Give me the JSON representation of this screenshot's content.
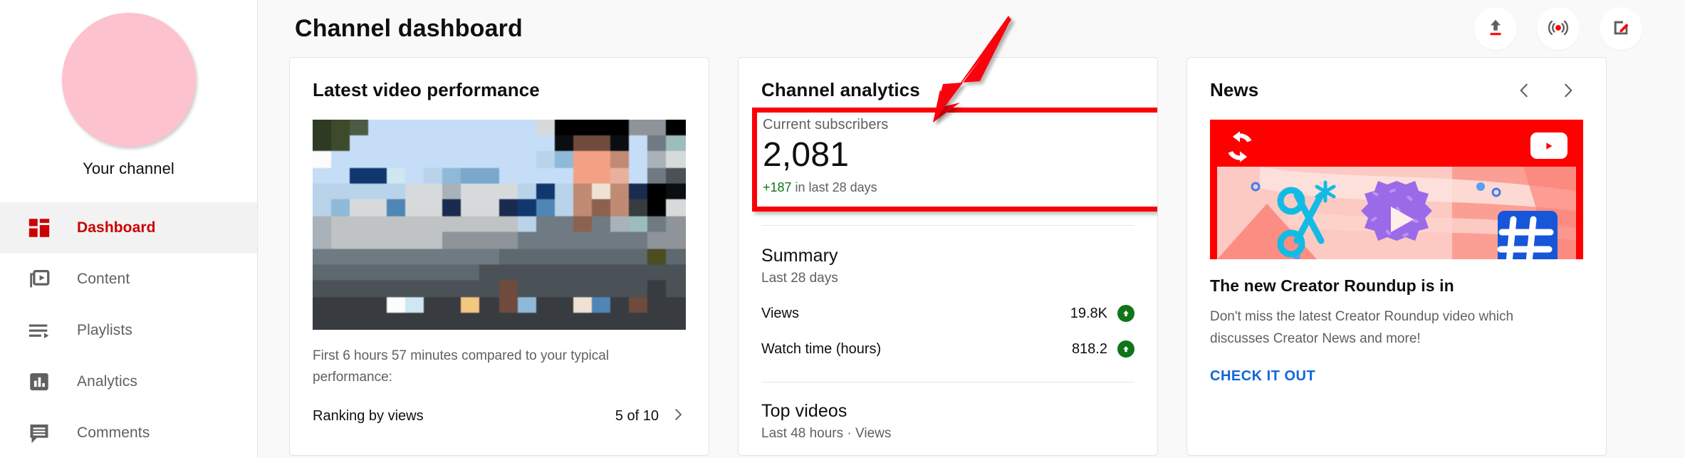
{
  "sidebar": {
    "channel_name": "Your channel",
    "avatar": {
      "icon": "channel-avatar",
      "color": "#fcc2cd"
    },
    "items": [
      {
        "label": "Dashboard",
        "icon": "dashboard-grid-icon",
        "active": true
      },
      {
        "label": "Content",
        "icon": "video-library-icon",
        "active": false
      },
      {
        "label": "Playlists",
        "icon": "playlist-icon",
        "active": false
      },
      {
        "label": "Analytics",
        "icon": "bar-chart-icon",
        "active": false
      },
      {
        "label": "Comments",
        "icon": "comment-bubble-icon",
        "active": false
      }
    ]
  },
  "header": {
    "title": "Channel dashboard",
    "actions": [
      {
        "name": "upload-video-button",
        "icon": "upload-arrow-icon",
        "tooltip": "Upload videos"
      },
      {
        "name": "go-live-button",
        "icon": "live-broadcast-icon",
        "tooltip": "Go live"
      },
      {
        "name": "create-post-button",
        "icon": "edit-square-pencil-icon",
        "tooltip": "Create post"
      }
    ]
  },
  "latest_video": {
    "title": "Latest video performance",
    "thumbnail_alt": "blurred video thumbnail",
    "performance_text": "First 6 hours 57 minutes compared to your typical performance:",
    "ranking_label": "Ranking by views",
    "ranking_value": "5 of 10",
    "chevron": "chevron-right-icon"
  },
  "analytics": {
    "title": "Channel analytics",
    "subscribers": {
      "label": "Current subscribers",
      "count": "2,081",
      "delta": "+187",
      "delta_suffix": " in last 28 days",
      "highlight_color": "#fb0007"
    },
    "summary": {
      "title": "Summary",
      "subtitle": "Last 28 days",
      "metrics": [
        {
          "label": "Views",
          "value": "19.8K",
          "trend": "up",
          "trend_color": "#107516"
        },
        {
          "label": "Watch time (hours)",
          "value": "818.2",
          "trend": "up",
          "trend_color": "#107516"
        }
      ]
    },
    "top_videos": {
      "title": "Top videos",
      "subtitle": "Last 48 hours · Views"
    }
  },
  "news": {
    "title": "News",
    "prev_icon": "chevron-left-icon",
    "next_icon": "chevron-right-icon",
    "banner": {
      "background": "#ff0000",
      "refresh_icon": "creator-roundup-refresh-icon",
      "youtube_icon": "youtube-play-badge-icon",
      "art_icons": [
        "scissors-icon",
        "gear-play-icon",
        "hashtag-icon"
      ]
    },
    "headline": "The new Creator Roundup is in",
    "body": "Don't miss the latest Creator Roundup video which discusses Creator News and more!",
    "cta": "CHECK IT OUT",
    "cta_color": "#1266da"
  },
  "annotation": {
    "arrow": "red-pointer-arrow",
    "color": "#fb0007"
  }
}
